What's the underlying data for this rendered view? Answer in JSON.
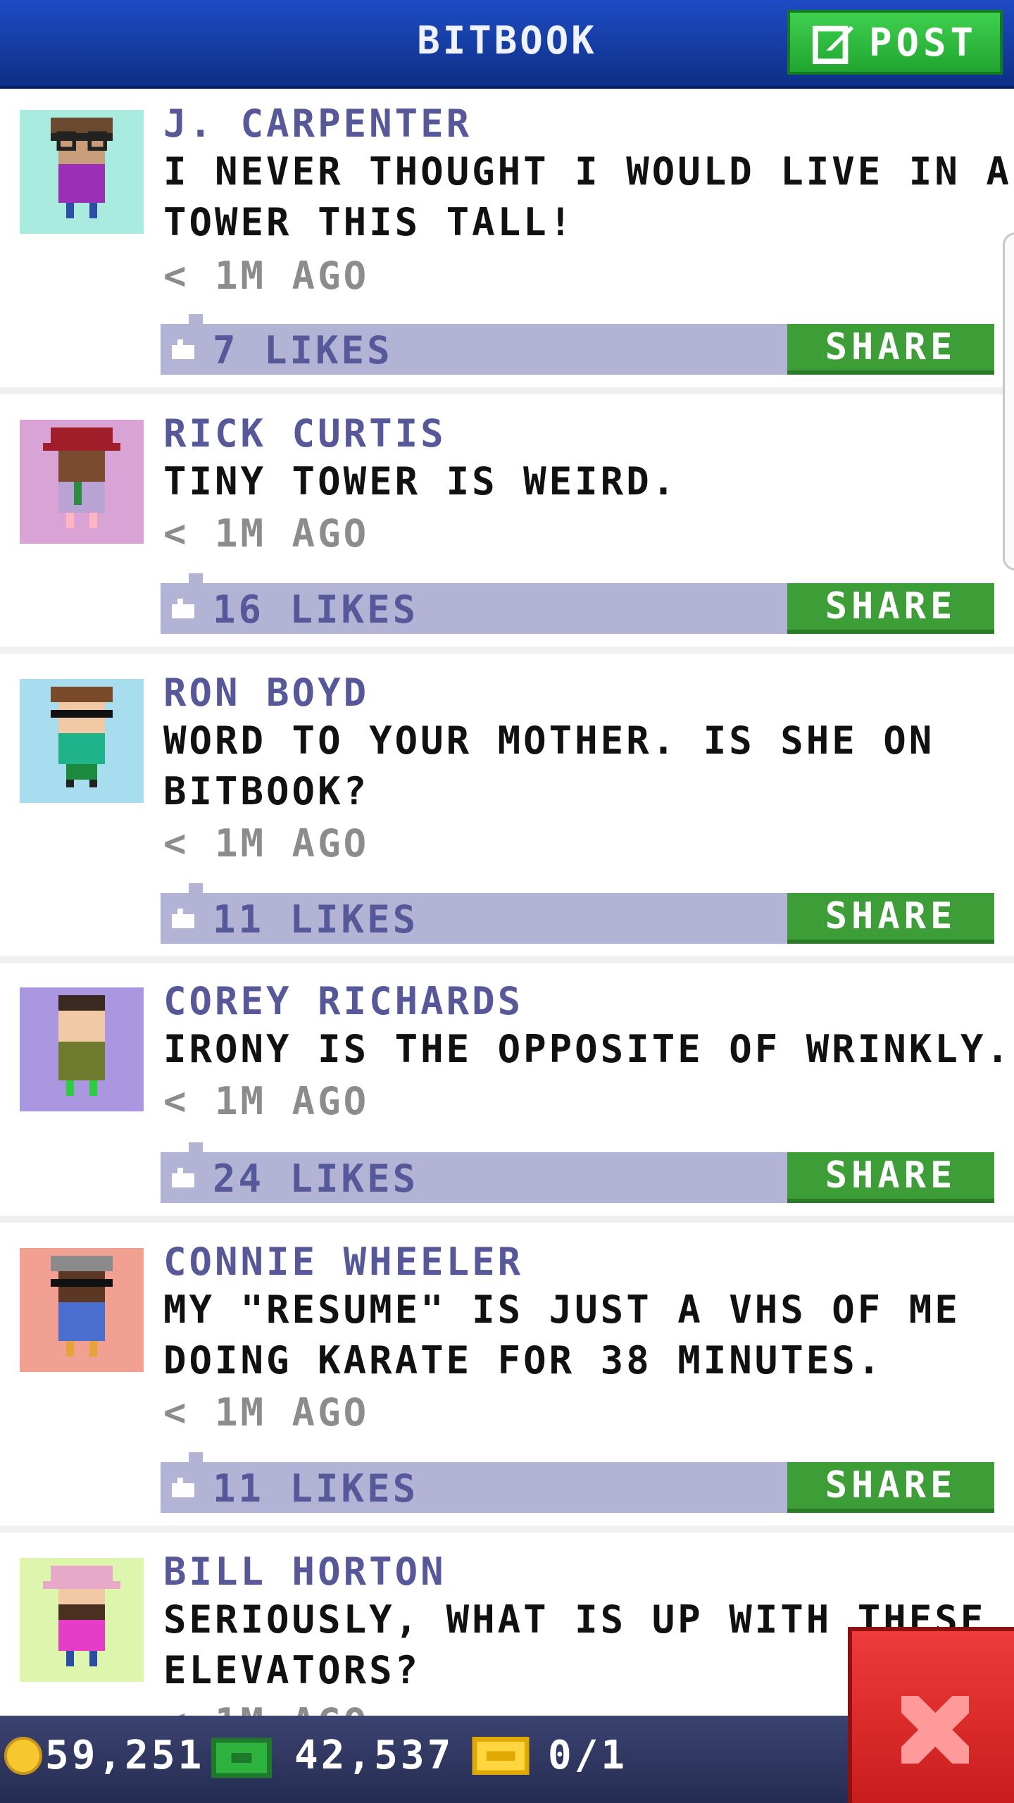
{
  "header": {
    "title": "BITBOOK",
    "post_label": "POST"
  },
  "posts": [
    {
      "author": "J. CARPENTER",
      "lines": [
        "I NEVER THOUGHT I WOULD LIVE IN A",
        "TOWER THIS TALL!"
      ],
      "time": "< 1M AGO",
      "likes": "7 LIKES",
      "share_label": "SHARE",
      "avatar_bg": "#a9ecdf"
    },
    {
      "author": "RICK CURTIS",
      "lines": [
        "TINY TOWER IS WEIRD."
      ],
      "time": "< 1M AGO",
      "likes": "16 LIKES",
      "share_label": "SHARE",
      "avatar_bg": "#d9a3d6"
    },
    {
      "author": "RON BOYD",
      "lines": [
        "WORD TO YOUR MOTHER. IS SHE ON",
        "BITBOOK?"
      ],
      "time": "< 1M AGO",
      "likes": "11 LIKES",
      "share_label": "SHARE",
      "avatar_bg": "#a8dcef"
    },
    {
      "author": "COREY RICHARDS",
      "lines": [
        "IRONY IS THE OPPOSITE OF WRINKLY."
      ],
      "time": "< 1M AGO",
      "likes": "24 LIKES",
      "share_label": "SHARE",
      "avatar_bg": "#ab97e0"
    },
    {
      "author": "CONNIE WHEELER",
      "lines": [
        "MY \"RESUME\" IS JUST A VHS OF ME",
        "DOING KARATE FOR 38 MINUTES."
      ],
      "time": "< 1M AGO",
      "likes": "11 LIKES",
      "share_label": "SHARE",
      "avatar_bg": "#f1a092"
    },
    {
      "author": "BILL HORTON",
      "lines": [
        "SERIOUSLY, WHAT IS UP WITH THESE",
        "ELEVATORS?"
      ],
      "time": "< 1M AGO",
      "avatar_bg": "#def5ae"
    }
  ],
  "bottom_bar": {
    "coins": "59,251",
    "bux": "42,537",
    "tickets": "0/1"
  },
  "colors": {
    "header": "#1f4cc4",
    "accent_green": "#3d9e38",
    "likes_bar": "#b3b3d6",
    "author": "#57589a",
    "close_red": "#e02a2a"
  },
  "icons": [
    "edit-icon",
    "like-icon",
    "coin-icon",
    "bux-icon",
    "ticket-icon",
    "close-icon"
  ]
}
